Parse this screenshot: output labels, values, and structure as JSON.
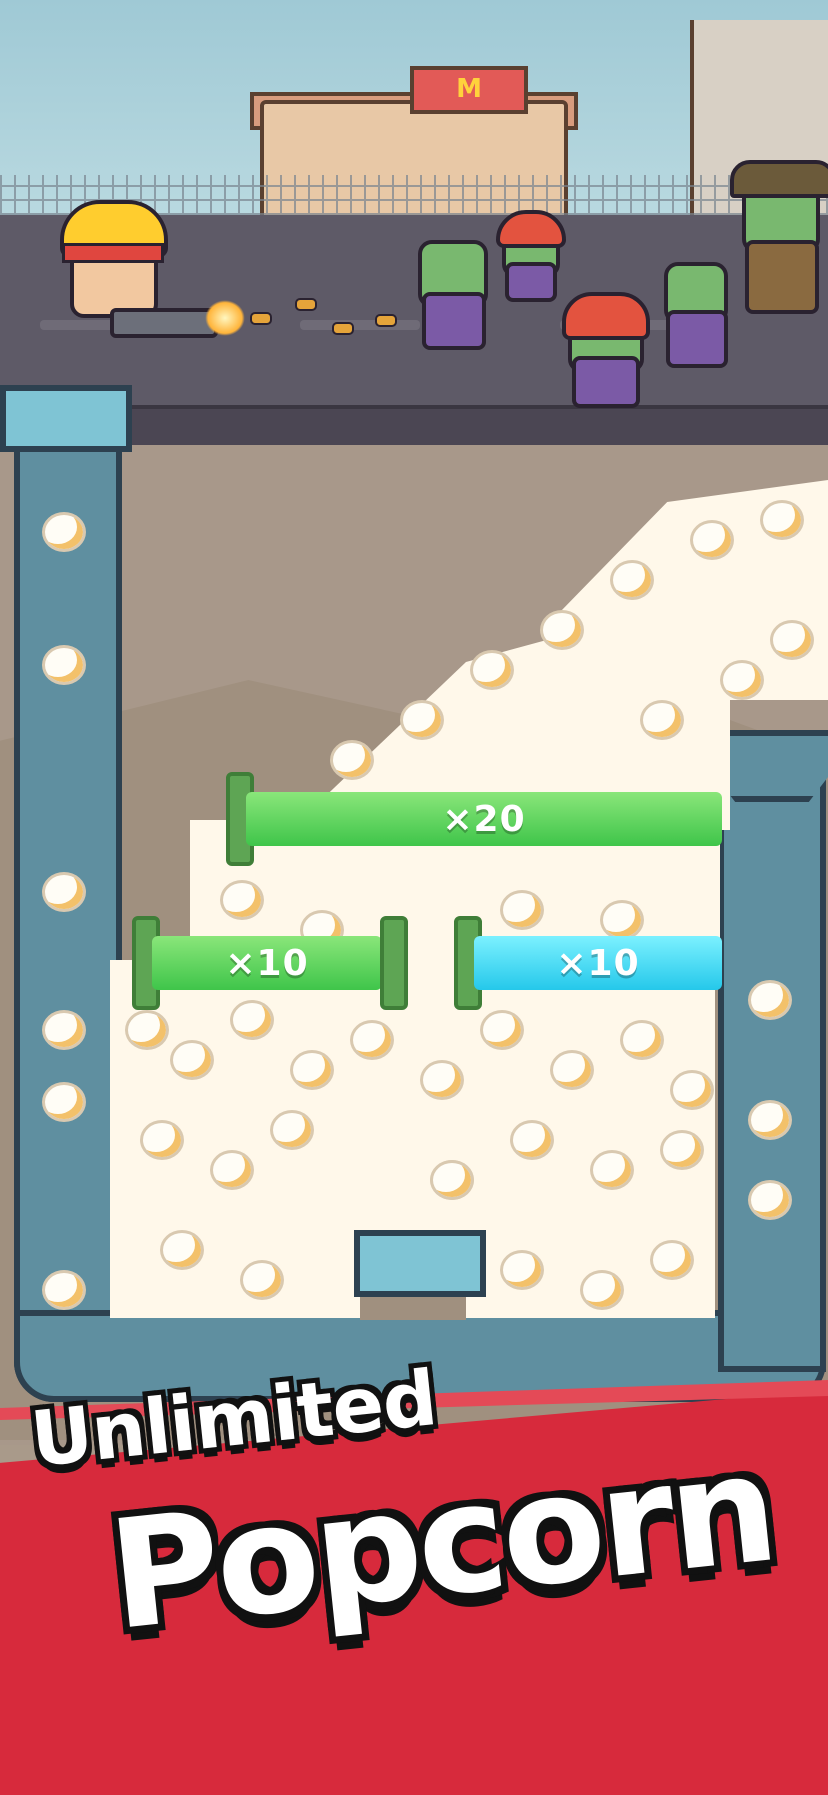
{
  "scene": {
    "multipliers": {
      "top": "×20",
      "left": "×10",
      "right": "×10"
    },
    "colors": {
      "gate_green": "#3fc54a",
      "gate_blue": "#25c8ea",
      "banner_red": "#d72a3c"
    }
  },
  "banner": {
    "line1": "Unlimited",
    "line2": "Popcorn"
  }
}
